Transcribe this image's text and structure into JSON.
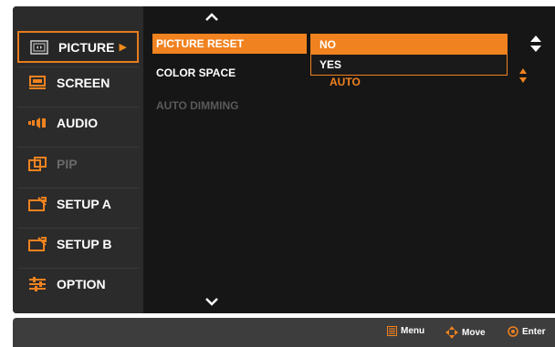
{
  "sidebar": {
    "items": [
      {
        "label": "PICTURE",
        "icon": "picture-icon"
      },
      {
        "label": "SCREEN",
        "icon": "screen-icon"
      },
      {
        "label": "AUDIO",
        "icon": "audio-icon"
      },
      {
        "label": "PIP",
        "icon": "pip-icon"
      },
      {
        "label": "SETUP A",
        "icon": "setup-icon"
      },
      {
        "label": "SETUP B",
        "icon": "setup-icon"
      },
      {
        "label": "OPTION",
        "icon": "option-icon"
      }
    ],
    "active_arrow": "▶"
  },
  "main": {
    "rows": [
      {
        "label": "PICTURE RESET"
      },
      {
        "label": "COLOR SPACE",
        "value": "AUTO"
      },
      {
        "label": "AUTO DIMMING"
      }
    ]
  },
  "dropdown": {
    "options": [
      "NO",
      "YES"
    ],
    "selected": "NO"
  },
  "footer": {
    "menu_label": "Menu",
    "move_label": "Move",
    "enter_label": "Enter"
  },
  "colors": {
    "accent": "#f0821f",
    "background": "#161616",
    "sidebar": "#2b2b2b"
  }
}
